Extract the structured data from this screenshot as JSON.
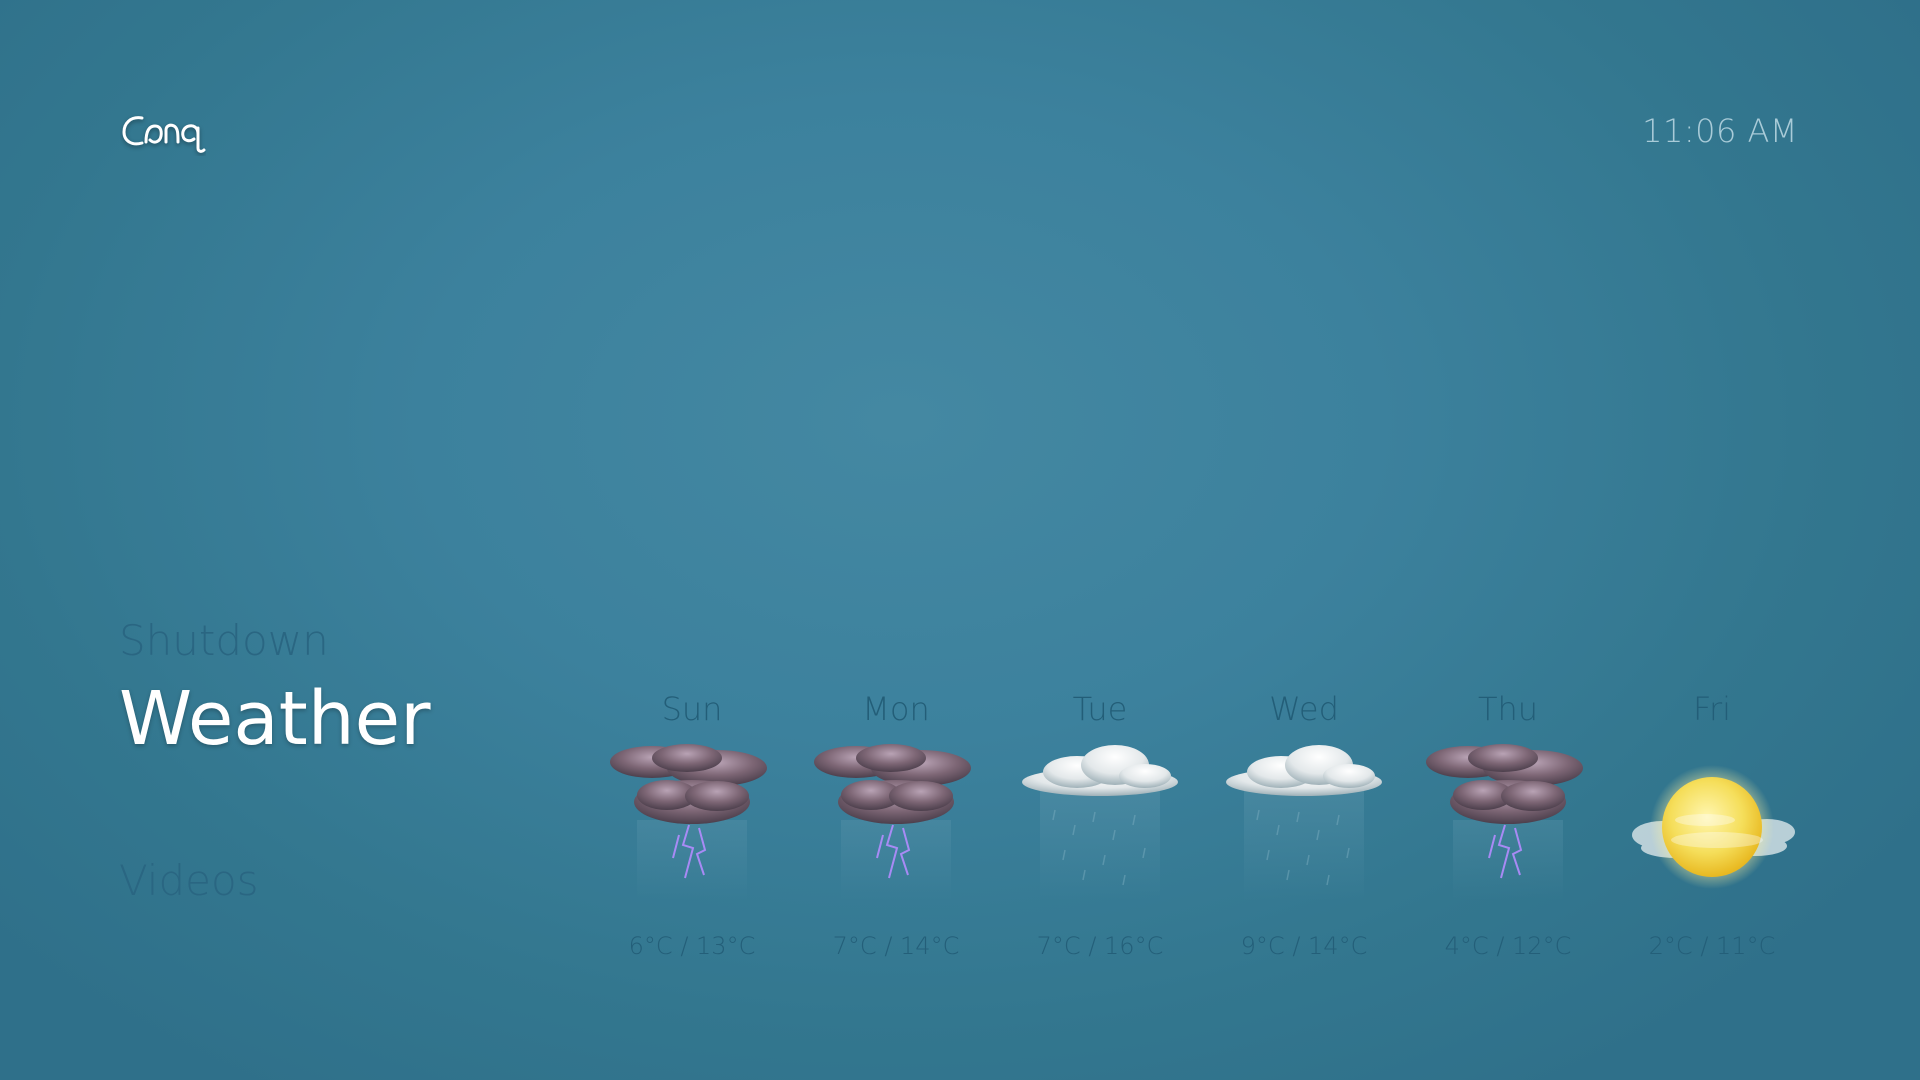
{
  "header": {
    "logo_icon": "emby-style-logo-icon",
    "clock": "11:06 AM"
  },
  "menu": {
    "items": [
      {
        "label": "Shutdown",
        "state": "inactive"
      },
      {
        "label": "Weather",
        "state": "active"
      },
      {
        "label": "Videos",
        "state": "inactive"
      }
    ]
  },
  "forecast": {
    "days": [
      {
        "name": "Sun",
        "temp": "6°C / 13°C",
        "icon": "thunderstorm-icon"
      },
      {
        "name": "Mon",
        "temp": "7°C / 14°C",
        "icon": "thunderstorm-icon"
      },
      {
        "name": "Tue",
        "temp": "7°C / 16°C",
        "icon": "cloud-rain-icon"
      },
      {
        "name": "Wed",
        "temp": "9°C / 14°C",
        "icon": "cloud-rain-icon"
      },
      {
        "name": "Thu",
        "temp": "4°C / 12°C",
        "icon": "thunderstorm-icon"
      },
      {
        "name": "Fri",
        "temp": "2°C / 11°C",
        "icon": "sun-cloud-icon"
      }
    ]
  },
  "colors": {
    "background": "#3c819d",
    "inactive_text": "#2a6682",
    "active_text": "#ffffff",
    "clock_text": "#a9cbd8"
  }
}
